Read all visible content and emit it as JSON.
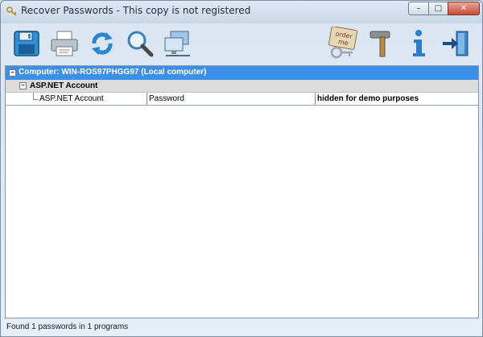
{
  "window": {
    "title": "Recover Passwords - This copy is not registered"
  },
  "titlebar": {
    "min_label": "–",
    "max_label": "□",
    "close_label": "✕"
  },
  "toolbar": {
    "buttons": [
      {
        "icon": "save-icon"
      },
      {
        "icon": "print-icon"
      },
      {
        "icon": "refresh-icon"
      },
      {
        "icon": "search-icon"
      },
      {
        "icon": "network-computer-icon"
      },
      {
        "icon": "order-me-icon",
        "label": "order me"
      },
      {
        "icon": "hammer-icon"
      },
      {
        "icon": "info-icon"
      },
      {
        "icon": "exit-icon"
      }
    ]
  },
  "tree": {
    "computer_label": "Computer: WIN-ROS97PHGG97 (Local computer)",
    "group_label": "ASP.NET Account",
    "items": [
      {
        "program": "ASP.NET Account",
        "field": "Password",
        "value": "hidden for demo purposes"
      }
    ]
  },
  "status": {
    "text": "Found 1 passwords in 1 programs"
  },
  "colors": {
    "selection": "#3d8ee6",
    "group_bg": "#dcdcdc"
  }
}
